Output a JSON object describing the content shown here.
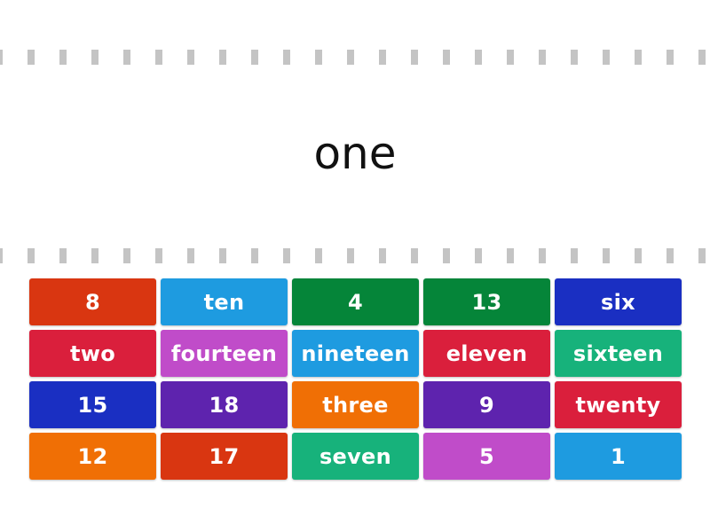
{
  "prompt": "one",
  "colors": {
    "red_orange": "#d93611",
    "sky_blue": "#1e9be0",
    "green": "#058539",
    "navy_blue": "#1a2fc2",
    "crimson": "#da1f3c",
    "magenta": "#c04cc9",
    "teal": "#17b27b",
    "purple": "#5e23ae",
    "orange": "#f06f05",
    "dash": "#c4c4c4"
  },
  "tiles": [
    {
      "label": "8",
      "color": "#d93611"
    },
    {
      "label": "ten",
      "color": "#1e9be0"
    },
    {
      "label": "4",
      "color": "#058539"
    },
    {
      "label": "13",
      "color": "#058539"
    },
    {
      "label": "six",
      "color": "#1a2fc2"
    },
    {
      "label": "two",
      "color": "#da1f3c"
    },
    {
      "label": "fourteen",
      "color": "#c04cc9"
    },
    {
      "label": "nineteen",
      "color": "#1e9be0"
    },
    {
      "label": "eleven",
      "color": "#da1f3c"
    },
    {
      "label": "sixteen",
      "color": "#17b27b"
    },
    {
      "label": "15",
      "color": "#1a2fc2"
    },
    {
      "label": "18",
      "color": "#5e23ae"
    },
    {
      "label": "three",
      "color": "#f06f05"
    },
    {
      "label": "9",
      "color": "#5e23ae"
    },
    {
      "label": "twenty",
      "color": "#da1f3c"
    },
    {
      "label": "12",
      "color": "#f06f05"
    },
    {
      "label": "17",
      "color": "#d93611"
    },
    {
      "label": "seven",
      "color": "#17b27b"
    },
    {
      "label": "5",
      "color": "#c04cc9"
    },
    {
      "label": "1",
      "color": "#1e9be0"
    }
  ]
}
